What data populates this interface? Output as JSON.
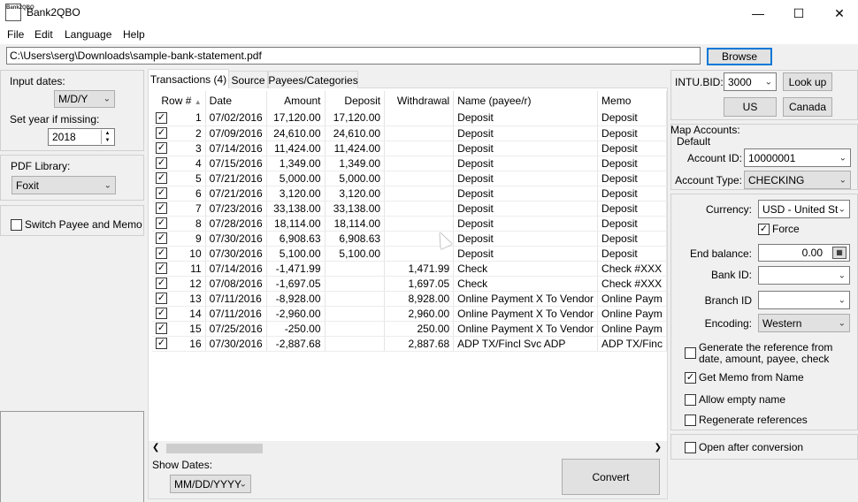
{
  "window": {
    "title": "Bank2QBO",
    "icon_text": "Bank2QBO",
    "minimize": "—",
    "maximize": "☐",
    "close": "✕"
  },
  "menu": [
    "File",
    "Edit",
    "Language",
    "Help"
  ],
  "file_path": "C:\\Users\\serg\\Downloads\\sample-bank-statement.pdf",
  "browse_label": "Browse",
  "left": {
    "input_dates_label": "Input dates:",
    "input_dates_value": "M/D/Y",
    "year_label": "Set year if missing:",
    "year_value": "2018",
    "pdf_label": "PDF Library:",
    "pdf_value": "Foxit",
    "switch_label": "Switch Payee and Memo"
  },
  "tabs": [
    "Transactions (4)",
    "Source",
    "Payees/Categories"
  ],
  "columns": [
    "Row #",
    "Date",
    "Amount",
    "Deposit",
    "Withdrawal",
    "Name (payee/r)",
    "Memo"
  ],
  "rows": [
    {
      "n": "1",
      "date": "07/02/2016",
      "amount": "17,120.00",
      "deposit": "17,120.00",
      "withdrawal": "",
      "name": "Deposit",
      "memo": "Deposit"
    },
    {
      "n": "2",
      "date": "07/09/2016",
      "amount": "24,610.00",
      "deposit": "24,610.00",
      "withdrawal": "",
      "name": "Deposit",
      "memo": "Deposit"
    },
    {
      "n": "3",
      "date": "07/14/2016",
      "amount": "11,424.00",
      "deposit": "11,424.00",
      "withdrawal": "",
      "name": "Deposit",
      "memo": "Deposit"
    },
    {
      "n": "4",
      "date": "07/15/2016",
      "amount": "1,349.00",
      "deposit": "1,349.00",
      "withdrawal": "",
      "name": "Deposit",
      "memo": "Deposit"
    },
    {
      "n": "5",
      "date": "07/21/2016",
      "amount": "5,000.00",
      "deposit": "5,000.00",
      "withdrawal": "",
      "name": "Deposit",
      "memo": "Deposit"
    },
    {
      "n": "6",
      "date": "07/21/2016",
      "amount": "3,120.00",
      "deposit": "3,120.00",
      "withdrawal": "",
      "name": "Deposit",
      "memo": "Deposit"
    },
    {
      "n": "7",
      "date": "07/23/2016",
      "amount": "33,138.00",
      "deposit": "33,138.00",
      "withdrawal": "",
      "name": "Deposit",
      "memo": "Deposit"
    },
    {
      "n": "8",
      "date": "07/28/2016",
      "amount": "18,114.00",
      "deposit": "18,114.00",
      "withdrawal": "",
      "name": "Deposit",
      "memo": "Deposit"
    },
    {
      "n": "9",
      "date": "07/30/2016",
      "amount": "6,908.63",
      "deposit": "6,908.63",
      "withdrawal": "",
      "name": "Deposit",
      "memo": "Deposit"
    },
    {
      "n": "10",
      "date": "07/30/2016",
      "amount": "5,100.00",
      "deposit": "5,100.00",
      "withdrawal": "",
      "name": "Deposit",
      "memo": "Deposit"
    },
    {
      "n": "11",
      "date": "07/14/2016",
      "amount": "-1,471.99",
      "deposit": "",
      "withdrawal": "1,471.99",
      "name": "Check",
      "memo": "Check #XXX"
    },
    {
      "n": "12",
      "date": "07/08/2016",
      "amount": "-1,697.05",
      "deposit": "",
      "withdrawal": "1,697.05",
      "name": "Check",
      "memo": "Check #XXX"
    },
    {
      "n": "13",
      "date": "07/11/2016",
      "amount": "-8,928.00",
      "deposit": "",
      "withdrawal": "8,928.00",
      "name": "Online Payment X To Vendor",
      "memo": "Online Paym"
    },
    {
      "n": "14",
      "date": "07/11/2016",
      "amount": "-2,960.00",
      "deposit": "",
      "withdrawal": "2,960.00",
      "name": "Online Payment X To Vendor",
      "memo": "Online Paym"
    },
    {
      "n": "15",
      "date": "07/25/2016",
      "amount": "-250.00",
      "deposit": "",
      "withdrawal": "250.00",
      "name": "Online Payment X To Vendor",
      "memo": "Online Paym"
    },
    {
      "n": "16",
      "date": "07/30/2016",
      "amount": "-2,887.68",
      "deposit": "",
      "withdrawal": "2,887.68",
      "name": "ADP TX/Fincl Svc ADP",
      "memo": "ADP TX/Finc"
    }
  ],
  "show_dates_label": "Show Dates:",
  "show_dates_value": "MM/DD/YYYY",
  "convert_label": "Convert",
  "right": {
    "intu_label": "INTU.BID:",
    "intu_value": "3000",
    "lookup_label": "Look up",
    "us_label": "US",
    "canada_label": "Canada",
    "map_accounts_label": "Map Accounts:",
    "default_label": "Default",
    "account_id_label": "Account ID:",
    "account_id_value": "10000001",
    "account_type_label": "Account Type:",
    "account_type_value": "CHECKING",
    "currency_label": "Currency:",
    "currency_value": "USD - United Sta",
    "force_label": "Force",
    "end_balance_label": "End balance:",
    "end_balance_value": "0.00",
    "bank_id_label": "Bank ID:",
    "branch_id_label": "Branch ID",
    "encoding_label": "Encoding:",
    "encoding_value": "Western",
    "generate_ref_label": "Generate the reference from date, amount, payee, check",
    "get_memo_label": "Get Memo from Name",
    "allow_empty_label": "Allow empty name",
    "regenerate_label": "Regenerate references",
    "open_after_label": "Open after conversion"
  }
}
